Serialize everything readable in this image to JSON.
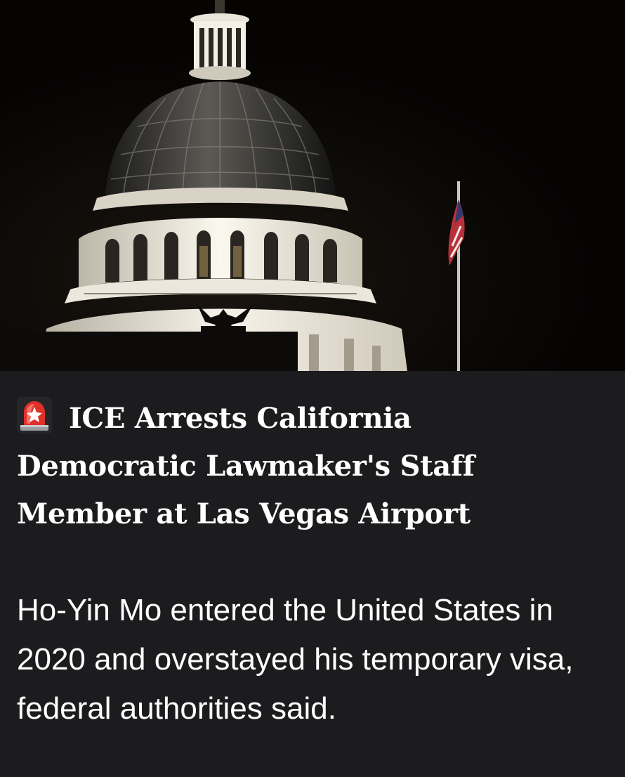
{
  "article": {
    "image": {
      "subject": "capitol-dome-night",
      "icons": [
        "flag-icon",
        "eagle-icon"
      ]
    },
    "headline_icon": "police-light-icon",
    "headline": "ICE Arrests California Democratic Lawmaker's Staff Member at Las Vegas Airport",
    "summary": "Ho-Yin Mo entered the United States in 2020 and overstayed his temporary visa, federal authorities said."
  },
  "colors": {
    "background": "#1c1c1e",
    "photo_sky": "#060504",
    "text": "#ffffff",
    "siren_red": "#e0302a"
  }
}
